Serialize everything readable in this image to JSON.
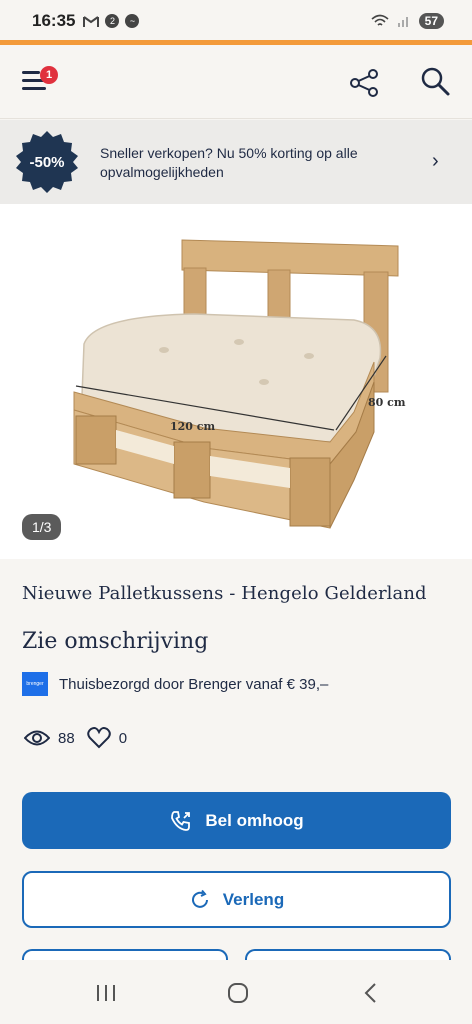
{
  "status_bar": {
    "time": "16:35",
    "battery": "57",
    "notification_icons": [
      "gmail-icon",
      "2-icon",
      "messenger-icon"
    ]
  },
  "header": {
    "menu_badge": "1",
    "icons": [
      "menu-icon",
      "share-icon",
      "search-icon"
    ]
  },
  "promo": {
    "badge_text": "-50%",
    "text": "Sneller verkopen? Nu 50% korting op alle opvalmogelijkheden"
  },
  "photo": {
    "counter": "1/3",
    "dimension_width": "120 cm",
    "dimension_depth": "80 cm"
  },
  "listing": {
    "title": "Nieuwe Palletkussens - Hengelo Gelderland",
    "price": "Zie omschrijving",
    "delivery_logo_text": "brenger",
    "delivery_text": "Thuisbezorgd door Brenger vanaf € 39,–",
    "views": "88",
    "favorites": "0"
  },
  "actions": {
    "primary_label": "Bel omhoog",
    "secondary_label": "Verleng"
  },
  "colors": {
    "accent_orange": "#f39a3a",
    "primary_blue": "#1b69b8",
    "navy_text": "#1f2a44",
    "badge_red": "#e0313e",
    "promo_badge_navy": "#1f3552"
  }
}
